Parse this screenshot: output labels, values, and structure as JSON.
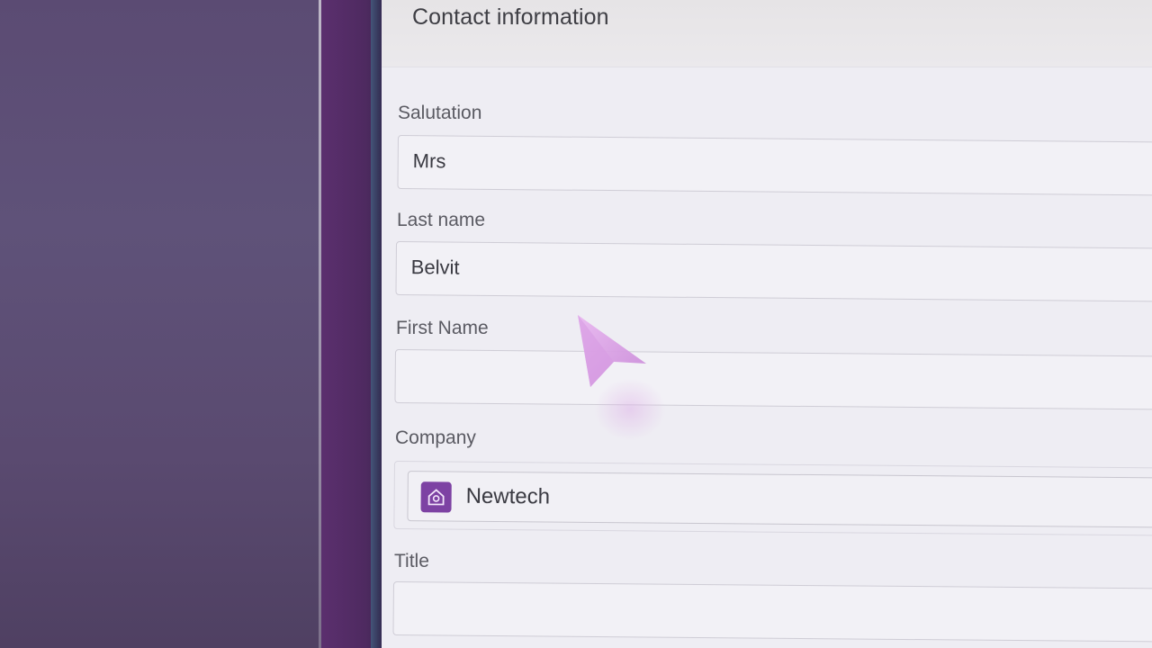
{
  "panel": {
    "title": "Contact information"
  },
  "form": {
    "salutation": {
      "label": "Salutation",
      "value": "Mrs"
    },
    "last_name": {
      "label": "Last name",
      "value": "Belvit"
    },
    "first_name": {
      "label": "First Name",
      "value": ""
    },
    "company": {
      "label": "Company",
      "value": "Newtech",
      "icon": "building-icon"
    },
    "title": {
      "label": "Title",
      "value": ""
    }
  },
  "colors": {
    "accent": "#7d42a3",
    "sidebar": "#5b2f6e",
    "cursor": "#d9a3e6"
  }
}
